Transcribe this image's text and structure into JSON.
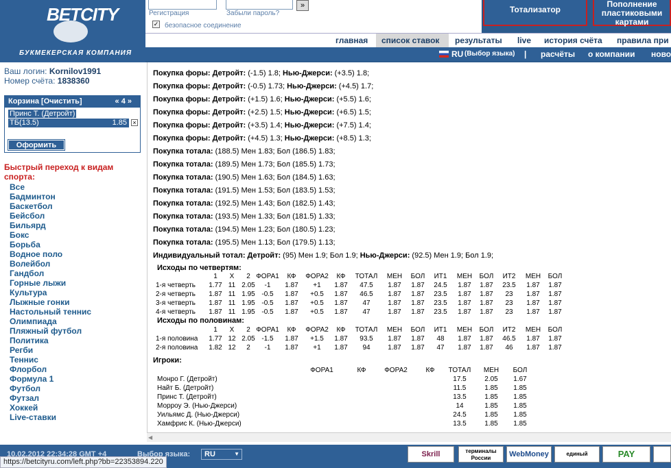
{
  "header": {
    "logo": "BETCITY",
    "logo_sub": "БУКМЕКЕРСКАЯ КОМПАНИЯ",
    "register_label": "Регистрация",
    "forgot_label": "Забыли пароль?",
    "go_label": "»",
    "safe_label": "безопасное соединение",
    "totalizator": "Тотализатор",
    "topup": "Пополнение пластиковыми картами"
  },
  "nav1": [
    "главная",
    "список ставок",
    "результаты",
    "live",
    "история счёта",
    "правила при"
  ],
  "nav2": {
    "lang": "RU",
    "lang_select": "(Выбор языка)",
    "sep": "|",
    "items": [
      "расчёты",
      "о компании",
      "ново"
    ]
  },
  "sidebar": {
    "login_label": "Ваш логин:",
    "login": "Kornilov1991",
    "account_label": "Номер счёта:",
    "account": "1838360",
    "basket_title": "Корзина [Очистить]",
    "basket_count": "« 4 »",
    "basket_event": "Принс Т. (Детройт)",
    "basket_bet": "ТБ(13.5)",
    "basket_coef": "1.85",
    "order": "Оформить",
    "quick_title": "Быстрый переход к видам спорта:",
    "sports": [
      "Все",
      "Бадминтон",
      "Баскетбол",
      "Бейсбол",
      "Бильярд",
      "Бокс",
      "Борьба",
      "Водное поло",
      "Волейбол",
      "Гандбол",
      "Горные лыжи",
      "Культура",
      "Лыжные гонки",
      "Настольный теннис",
      "Олимпиада",
      "Пляжный футбол",
      "Политика",
      "Регби",
      "Теннис",
      "Флорбол",
      "Формула 1",
      "Футбол",
      "Футзал",
      "Хоккей",
      "Live-ставки"
    ]
  },
  "bets": [
    {
      "l": "Покупка форы: Детройт:",
      "a": " (-1.5) 1.8; ",
      "l2": "Нью-Джерси:",
      "b": " (+3.5) 1.8;"
    },
    {
      "l": "Покупка форы: Детройт:",
      "a": " (-0.5) 1.73; ",
      "l2": "Нью-Джерси:",
      "b": " (+4.5) 1.7;"
    },
    {
      "l": "Покупка форы: Детройт:",
      "a": " (+1.5) 1.6; ",
      "l2": "Нью-Джерси:",
      "b": " (+5.5) 1.6;"
    },
    {
      "l": "Покупка форы: Детройт:",
      "a": " (+2.5) 1.5; ",
      "l2": "Нью-Джерси:",
      "b": " (+6.5) 1.5;"
    },
    {
      "l": "Покупка форы: Детройт:",
      "a": " (+3.5) 1.4; ",
      "l2": "Нью-Джерси:",
      "b": " (+7.5) 1.4;"
    },
    {
      "l": "Покупка форы: Детройт:",
      "a": " (+4.5) 1.3; ",
      "l2": "Нью-Джерси:",
      "b": " (+8.5) 1.3;"
    },
    {
      "l": "Покупка тотала:",
      "a": " (188.5) Мен 1.83; Бол (186.5) 1.83;",
      "l2": "",
      "b": ""
    },
    {
      "l": "Покупка тотала:",
      "a": " (189.5) Мен 1.73; Бол (185.5) 1.73;",
      "l2": "",
      "b": ""
    },
    {
      "l": "Покупка тотала:",
      "a": " (190.5) Мен 1.63; Бол (184.5) 1.63;",
      "l2": "",
      "b": ""
    },
    {
      "l": "Покупка тотала:",
      "a": " (191.5) Мен 1.53; Бол (183.5) 1.53;",
      "l2": "",
      "b": ""
    },
    {
      "l": "Покупка тотала:",
      "a": " (192.5) Мен 1.43; Бол (182.5) 1.43;",
      "l2": "",
      "b": ""
    },
    {
      "l": "Покупка тотала:",
      "a": " (193.5) Мен 1.33; Бол (181.5) 1.33;",
      "l2": "",
      "b": ""
    },
    {
      "l": "Покупка тотала:",
      "a": " (194.5) Мен 1.23; Бол (180.5) 1.23;",
      "l2": "",
      "b": ""
    },
    {
      "l": "Покупка тотала:",
      "a": " (195.5) Мен 1.13; Бол (179.5) 1.13;",
      "l2": "",
      "b": ""
    },
    {
      "l": "Индивидуальный тотал: Детройт:",
      "a": " (95) Мен 1.9; Бол 1.9; ",
      "l2": "Нью-Джерси:",
      "b": " (92.5) Мен 1.9; Бол 1.9;"
    }
  ],
  "quarters": {
    "title": "Исходы по четвертям:",
    "header": [
      "",
      "1",
      "X",
      "2",
      "ФОРА1",
      "КФ",
      "ФОРА2",
      "КФ",
      "ТОТАЛ",
      "МЕН",
      "БОЛ",
      "ИТ1",
      "МЕН",
      "БОЛ",
      "ИТ2",
      "МЕН",
      "БОЛ"
    ],
    "rows": [
      [
        "1-я четверть",
        "1.77",
        "11",
        "2.05",
        "-1",
        "1.87",
        "+1",
        "1.87",
        "47.5",
        "1.87",
        "1.87",
        "24.5",
        "1.87",
        "1.87",
        "23.5",
        "1.87",
        "1.87"
      ],
      [
        "2-я четверть",
        "1.87",
        "11",
        "1.95",
        "-0.5",
        "1.87",
        "+0.5",
        "1.87",
        "46.5",
        "1.87",
        "1.87",
        "23.5",
        "1.87",
        "1.87",
        "23",
        "1.87",
        "1.87"
      ],
      [
        "3-я четверть",
        "1.87",
        "11",
        "1.95",
        "-0.5",
        "1.87",
        "+0.5",
        "1.87",
        "47",
        "1.87",
        "1.87",
        "23.5",
        "1.87",
        "1.87",
        "23",
        "1.87",
        "1.87"
      ],
      [
        "4-я четверть",
        "1.87",
        "11",
        "1.95",
        "-0.5",
        "1.87",
        "+0.5",
        "1.87",
        "47",
        "1.87",
        "1.87",
        "23.5",
        "1.87",
        "1.87",
        "23",
        "1.87",
        "1.87"
      ]
    ]
  },
  "halves": {
    "title": "Исходы по половинам:",
    "header": [
      "",
      "1",
      "X",
      "2",
      "ФОРА1",
      "КФ",
      "ФОРА2",
      "КФ",
      "ТОТАЛ",
      "МЕН",
      "БОЛ",
      "ИТ1",
      "МЕН",
      "БОЛ",
      "ИТ2",
      "МЕН",
      "БОЛ"
    ],
    "rows": [
      [
        "1-я половина",
        "1.77",
        "12",
        "2.05",
        "-1.5",
        "1.87",
        "+1.5",
        "1.87",
        "93.5",
        "1.87",
        "1.87",
        "48",
        "1.87",
        "1.87",
        "46.5",
        "1.87",
        "1.87"
      ],
      [
        "2-я половина",
        "1.82",
        "12",
        "2",
        "-1",
        "1.87",
        "+1",
        "1.87",
        "94",
        "1.87",
        "1.87",
        "47",
        "1.87",
        "1.87",
        "46",
        "1.87",
        "1.87"
      ]
    ]
  },
  "players": {
    "title": "Игроки:",
    "header": [
      "",
      "ФОРА1",
      "КФ",
      "ФОРА2",
      "КФ",
      "ТОТАЛ",
      "МЕН",
      "БОЛ"
    ],
    "rows": [
      [
        "Монро Г. (Детройт)",
        "",
        "",
        "",
        "",
        "17.5",
        "2.05",
        "1.67"
      ],
      [
        "Найт Б. (Детройт)",
        "",
        "",
        "",
        "",
        "11.5",
        "1.85",
        "1.85"
      ],
      [
        "Принс Т. (Детройт)",
        "",
        "",
        "",
        "",
        "13.5",
        "1.85",
        "1.85"
      ],
      [
        "Морроу Э. (Нью-Джерси)",
        "",
        "",
        "",
        "",
        "14",
        "1.85",
        "1.85"
      ],
      [
        "Уильямс Д. (Нью-Джерси)",
        "",
        "",
        "",
        "",
        "24.5",
        "1.85",
        "1.85"
      ],
      [
        "Хамфрис К. (Нью-Джерси)",
        "",
        "",
        "",
        "",
        "13.5",
        "1.85",
        "1.85"
      ]
    ]
  },
  "footer": {
    "date": "10.02.2012 22:34:28 GMT +4",
    "lang_label": "Выбор языка:",
    "lang": "RU",
    "payments": [
      "Skrill",
      "терминалы России",
      "WebMoney",
      "единый кошелек",
      "PAY"
    ]
  },
  "status_url": "https://betcityru.com/left.php?bb=22353894.220"
}
